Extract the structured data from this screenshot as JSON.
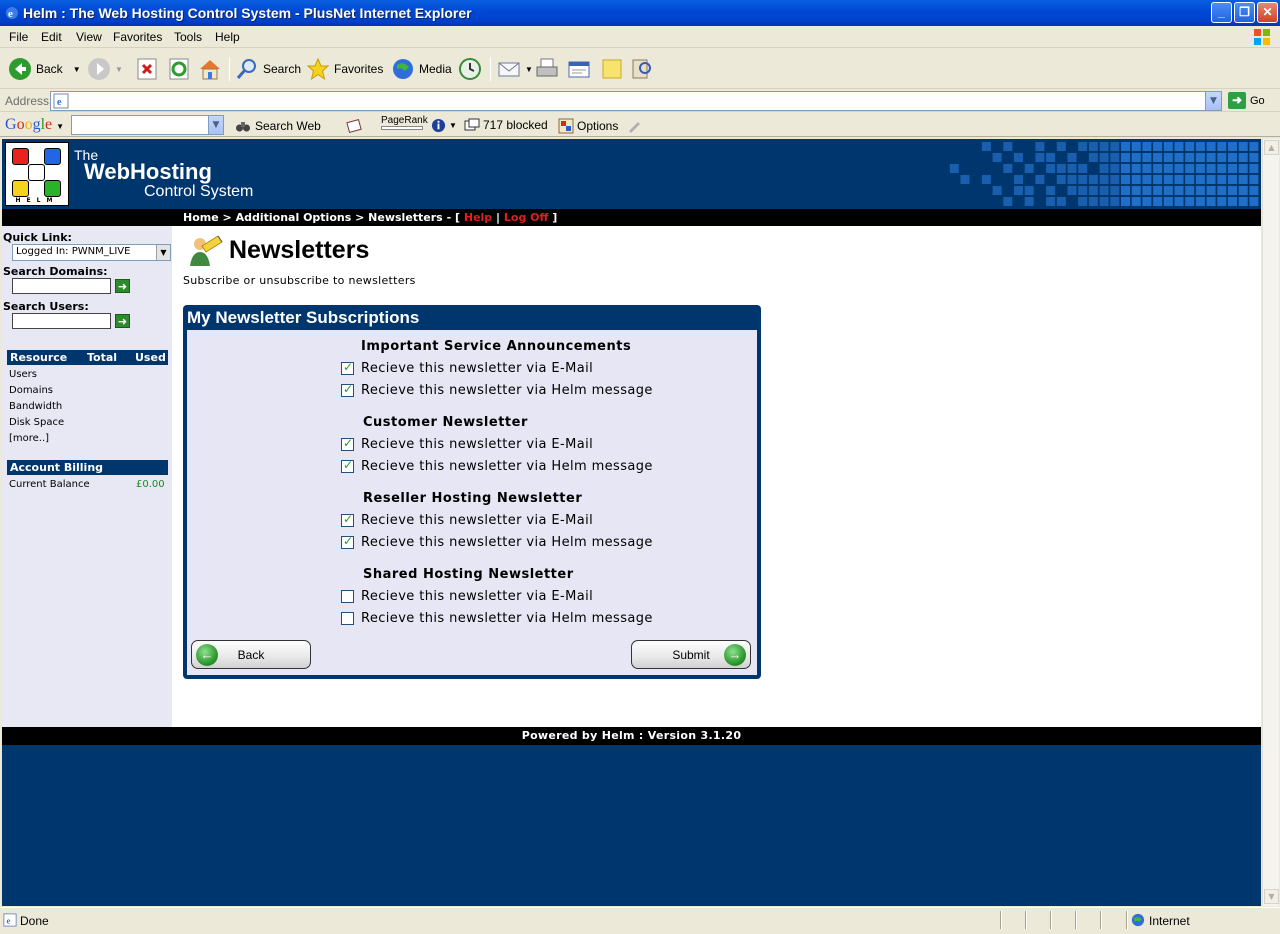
{
  "window": {
    "title": "Helm : The Web Hosting Control System - PlusNet Internet Explorer",
    "controls": [
      "_",
      "❐",
      "✕"
    ]
  },
  "menu": [
    "File",
    "Edit",
    "View",
    "Favorites",
    "Tools",
    "Help"
  ],
  "toolbar": {
    "back": "Back",
    "search": "Search",
    "favorites": "Favorites",
    "media": "Media"
  },
  "address": {
    "label": "Address",
    "value": "",
    "go": "Go"
  },
  "googlebar": {
    "logo": "Google",
    "search_web": "Search Web",
    "pagerank": "PageRank",
    "blocked": "717 blocked",
    "options": "Options"
  },
  "header": {
    "brand_line1": "The",
    "brand_line2": "WebHosting",
    "brand_line3": "Control System",
    "logo_text": "HELM",
    "logo_colors": [
      "#e8231f",
      "#2266e8",
      "#f5d21c",
      "#26b526"
    ]
  },
  "nav": {
    "home": "Home",
    "sep": ">",
    "additional": "Additional Options",
    "newsletters": "Newsletters",
    "dash": "- [",
    "help": "Help",
    "pipe": "|",
    "logoff": "Log Off",
    "close": "]"
  },
  "sidebar": {
    "quick_link_label": "Quick Link:",
    "quick_link_value": "Logged In: PWNM_LIVE",
    "search_domains_label": "Search Domains:",
    "search_users_label": "Search Users:",
    "resource_head": {
      "resource": "Resource",
      "total": "Total",
      "used": "Used"
    },
    "resources": [
      "Users",
      "Domains",
      "Bandwidth",
      "Disk Space",
      "[more..]"
    ],
    "billing_head": "Account Billing",
    "balance_label": "Current Balance",
    "balance_value": "£0.00"
  },
  "content": {
    "title": "Newsletters",
    "subtitle": "Subscribe or unsubscribe to newsletters",
    "panel_title": "My Newsletter Subscriptions",
    "groups": [
      {
        "name": "Important Service Announcements",
        "email": true,
        "helm": true
      },
      {
        "name": "Customer Newsletter",
        "email": true,
        "helm": true
      },
      {
        "name": "Reseller Hosting Newsletter",
        "email": true,
        "helm": true
      },
      {
        "name": "Shared Hosting Newsletter",
        "email": false,
        "helm": false
      }
    ],
    "opt_email": "Recieve this newsletter via E-Mail",
    "opt_helm": "Recieve this newsletter via Helm message",
    "back_button": "Back",
    "submit_button": "Submit"
  },
  "footer": "Powered by Helm  :  Version 3.1.20",
  "status": {
    "text": "Done",
    "zone": "Internet"
  }
}
